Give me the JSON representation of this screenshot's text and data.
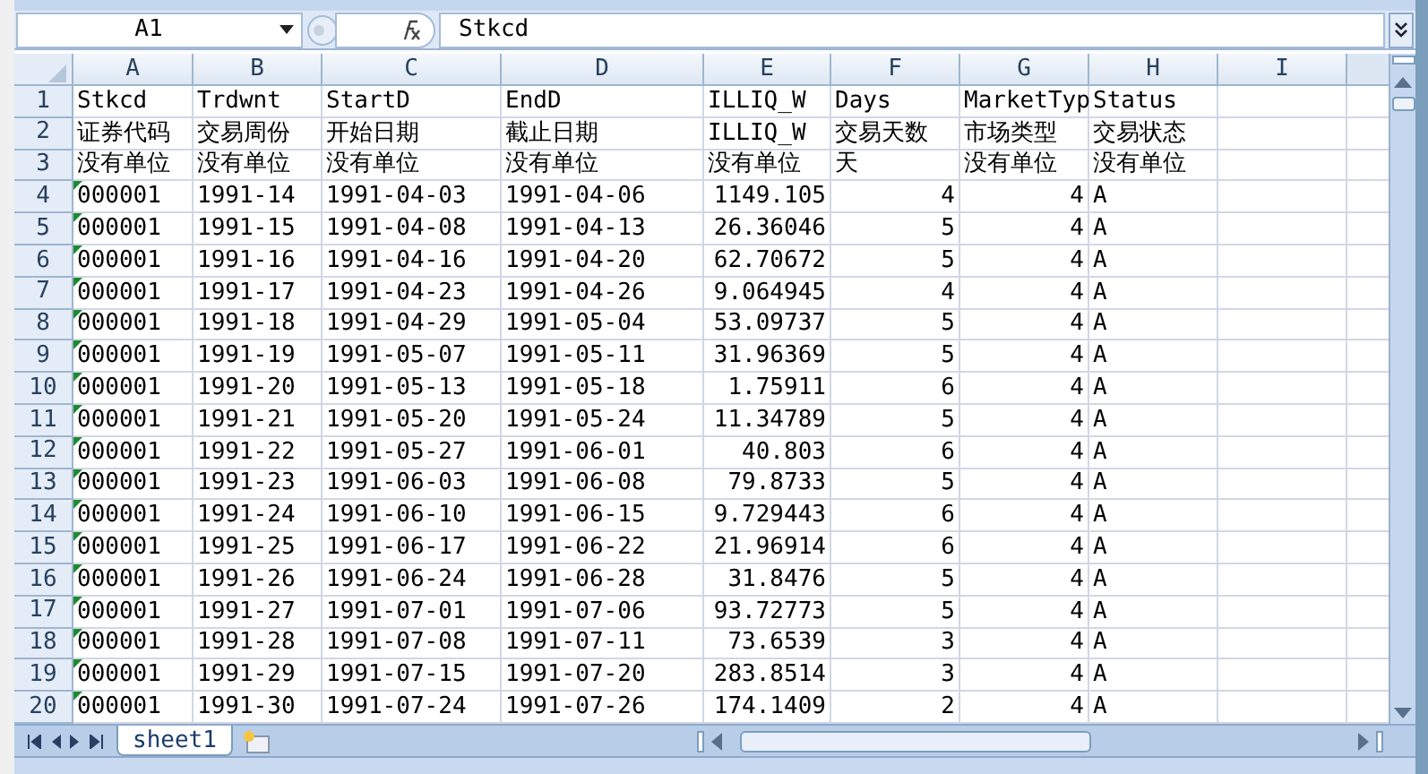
{
  "name_box": "A1",
  "formula": "Stkcd",
  "columns": [
    {
      "letter": "A",
      "kind": "text"
    },
    {
      "letter": "B",
      "kind": "text"
    },
    {
      "letter": "C",
      "kind": "text"
    },
    {
      "letter": "D",
      "kind": "text"
    },
    {
      "letter": "E",
      "kind": "number"
    },
    {
      "letter": "F",
      "kind": "number"
    },
    {
      "letter": "G",
      "kind": "number"
    },
    {
      "letter": "H",
      "kind": "text"
    },
    {
      "letter": "I",
      "kind": "text"
    }
  ],
  "header_rows": [
    {
      "number": "1",
      "cells": [
        "Stkcd",
        "Trdwnt",
        "StartD",
        "EndD",
        "ILLIQ_W",
        "Days",
        "MarketTyp",
        "Status"
      ]
    },
    {
      "number": "2",
      "cells": [
        "证券代码",
        "交易周份",
        "开始日期",
        "截止日期",
        "ILLIQ_W",
        "交易天数",
        "市场类型",
        "交易状态"
      ]
    },
    {
      "number": "3",
      "cells": [
        "没有单位",
        "没有单位",
        "没有单位",
        "没有单位",
        "没有单位",
        "天",
        "没有单位",
        "没有单位"
      ]
    }
  ],
  "rows": [
    {
      "number": "4",
      "text_flag": true,
      "cells": [
        "000001",
        "1991-14",
        "1991-04-03",
        "1991-04-06",
        "1149.105",
        "4",
        "4",
        "A"
      ]
    },
    {
      "number": "5",
      "text_flag": true,
      "cells": [
        "000001",
        "1991-15",
        "1991-04-08",
        "1991-04-13",
        "26.36046",
        "5",
        "4",
        "A"
      ]
    },
    {
      "number": "6",
      "text_flag": true,
      "cells": [
        "000001",
        "1991-16",
        "1991-04-16",
        "1991-04-20",
        "62.70672",
        "5",
        "4",
        "A"
      ]
    },
    {
      "number": "7",
      "text_flag": true,
      "cells": [
        "000001",
        "1991-17",
        "1991-04-23",
        "1991-04-26",
        "9.064945",
        "4",
        "4",
        "A"
      ]
    },
    {
      "number": "8",
      "text_flag": true,
      "cells": [
        "000001",
        "1991-18",
        "1991-04-29",
        "1991-05-04",
        "53.09737",
        "5",
        "4",
        "A"
      ]
    },
    {
      "number": "9",
      "text_flag": true,
      "cells": [
        "000001",
        "1991-19",
        "1991-05-07",
        "1991-05-11",
        "31.96369",
        "5",
        "4",
        "A"
      ]
    },
    {
      "number": "10",
      "text_flag": true,
      "cells": [
        "000001",
        "1991-20",
        "1991-05-13",
        "1991-05-18",
        "1.75911",
        "6",
        "4",
        "A"
      ]
    },
    {
      "number": "11",
      "text_flag": true,
      "cells": [
        "000001",
        "1991-21",
        "1991-05-20",
        "1991-05-24",
        "11.34789",
        "5",
        "4",
        "A"
      ]
    },
    {
      "number": "12",
      "text_flag": true,
      "cells": [
        "000001",
        "1991-22",
        "1991-05-27",
        "1991-06-01",
        "40.803",
        "6",
        "4",
        "A"
      ]
    },
    {
      "number": "13",
      "text_flag": true,
      "cells": [
        "000001",
        "1991-23",
        "1991-06-03",
        "1991-06-08",
        "79.8733",
        "5",
        "4",
        "A"
      ]
    },
    {
      "number": "14",
      "text_flag": true,
      "cells": [
        "000001",
        "1991-24",
        "1991-06-10",
        "1991-06-15",
        "9.729443",
        "6",
        "4",
        "A"
      ]
    },
    {
      "number": "15",
      "text_flag": true,
      "cells": [
        "000001",
        "1991-25",
        "1991-06-17",
        "1991-06-22",
        "21.96914",
        "6",
        "4",
        "A"
      ]
    },
    {
      "number": "16",
      "text_flag": true,
      "cells": [
        "000001",
        "1991-26",
        "1991-06-24",
        "1991-06-28",
        "31.8476",
        "5",
        "4",
        "A"
      ]
    },
    {
      "number": "17",
      "text_flag": true,
      "cells": [
        "000001",
        "1991-27",
        "1991-07-01",
        "1991-07-06",
        "93.72773",
        "5",
        "4",
        "A"
      ]
    },
    {
      "number": "18",
      "text_flag": true,
      "cells": [
        "000001",
        "1991-28",
        "1991-07-08",
        "1991-07-11",
        "73.6539",
        "3",
        "4",
        "A"
      ]
    },
    {
      "number": "19",
      "text_flag": true,
      "cells": [
        "000001",
        "1991-29",
        "1991-07-15",
        "1991-07-20",
        "283.8514",
        "3",
        "4",
        "A"
      ]
    },
    {
      "number": "20",
      "text_flag": true,
      "cells": [
        "000001",
        "1991-30",
        "1991-07-24",
        "1991-07-26",
        "174.1409",
        "2",
        "4",
        "A"
      ]
    }
  ],
  "sheet_tabs": [
    {
      "label": "sheet1",
      "selected": true
    }
  ]
}
